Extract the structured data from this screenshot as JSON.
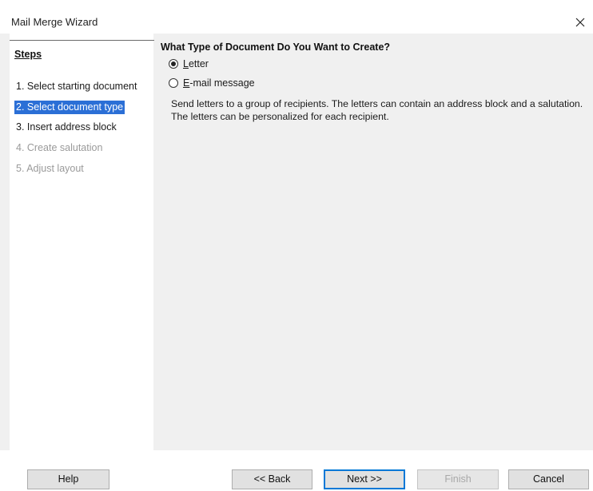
{
  "window": {
    "title": "Mail Merge Wizard",
    "close_icon": "close-icon"
  },
  "steps": {
    "heading": "Steps",
    "items": [
      {
        "label": "1. Select starting document",
        "state": "done"
      },
      {
        "label": "2. Select document type",
        "state": "active"
      },
      {
        "label": "3. Insert address block",
        "state": "done"
      },
      {
        "label": "4. Create salutation",
        "state": "disabled"
      },
      {
        "label": "5. Adjust layout",
        "state": "disabled"
      }
    ]
  },
  "main": {
    "title": "What Type of Document Do You Want to Create?",
    "options": [
      {
        "label": "Letter",
        "checked": true
      },
      {
        "label": "E-mail message",
        "checked": false
      }
    ],
    "description": "Send letters to a group of recipients. The letters can contain an address block and a salutation. The letters can be personalized for each recipient."
  },
  "buttons": {
    "help": "Help",
    "back": "<< Back",
    "next": "Next >>",
    "finish": "Finish",
    "cancel": "Cancel"
  },
  "colors": {
    "active_step_bg": "#2b6fd6",
    "primary_border": "#0078d7"
  }
}
